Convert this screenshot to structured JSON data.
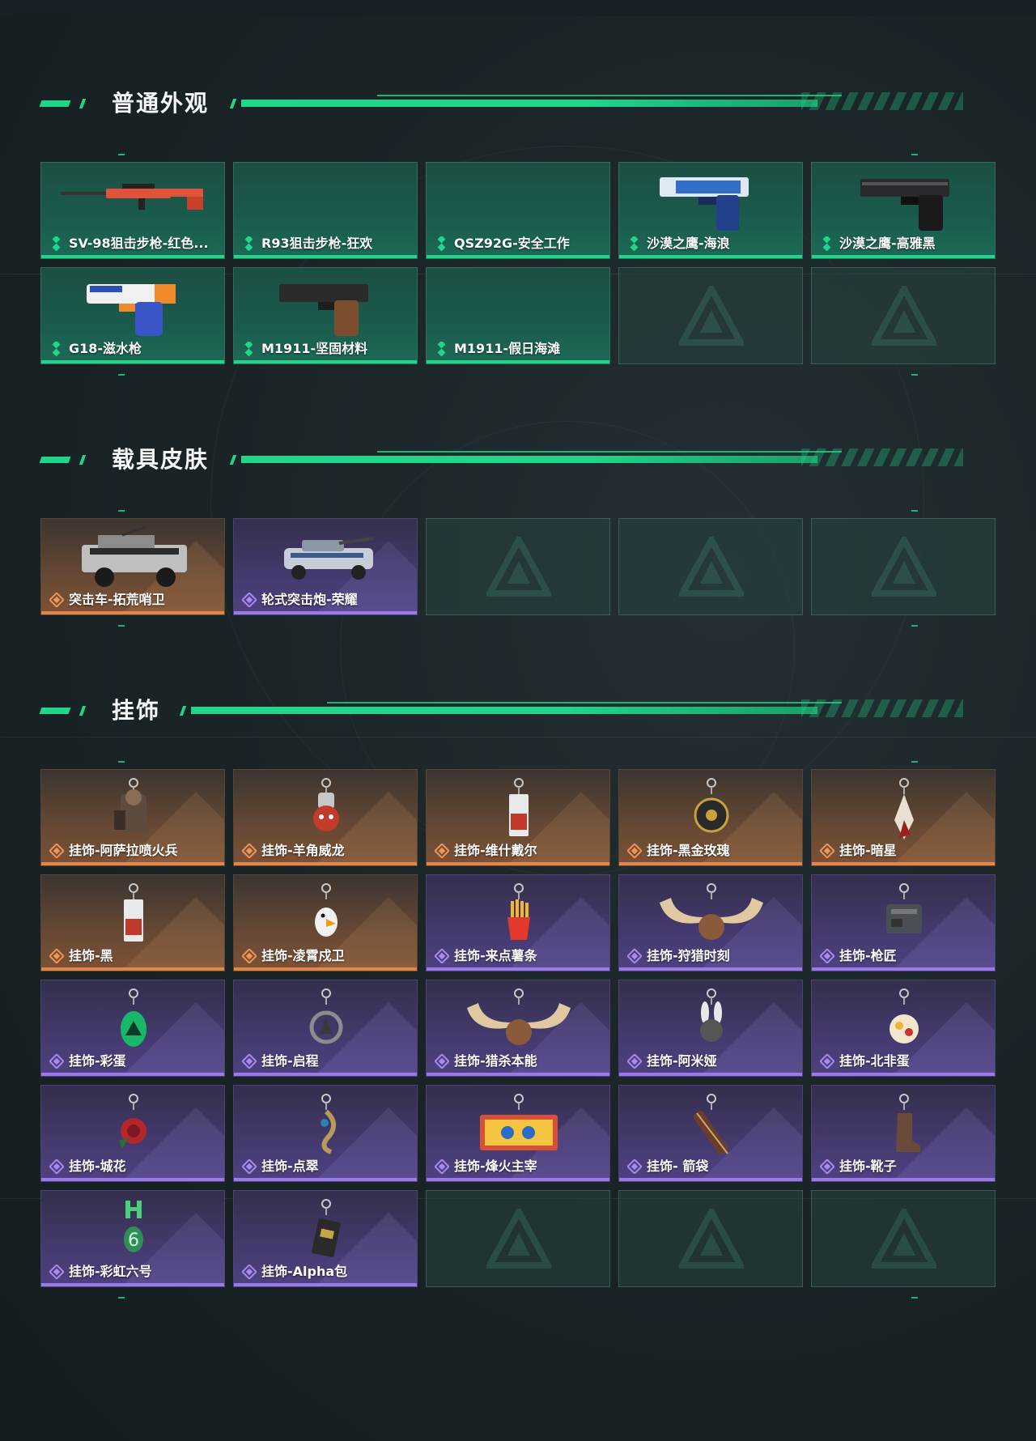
{
  "sections": [
    {
      "title": "普通外观",
      "items": [
        {
          "label": "SV-98狙击步枪-红色...",
          "rarity": "green",
          "art": "sniper-red"
        },
        {
          "label": "R93狙击步枪-狂欢",
          "rarity": "green",
          "art": "none"
        },
        {
          "label": "QSZ92G-安全工作",
          "rarity": "green",
          "art": "none"
        },
        {
          "label": "沙漠之鹰-海浪",
          "rarity": "green",
          "art": "pistol-blue"
        },
        {
          "label": "沙漠之鹰-高雅黑",
          "rarity": "green",
          "art": "pistol-black"
        },
        {
          "label": "G18-滋水枪",
          "rarity": "green",
          "art": "watergun"
        },
        {
          "label": "M1911-坚固材料",
          "rarity": "green",
          "art": "pistol-wood"
        },
        {
          "label": "M1911-假日海滩",
          "rarity": "green",
          "art": "none"
        },
        {
          "label": "",
          "rarity": "empty"
        },
        {
          "label": "",
          "rarity": "empty"
        }
      ]
    },
    {
      "title": "载具皮肤",
      "items": [
        {
          "label": "突击车-拓荒哨卫",
          "rarity": "orange",
          "art": "truck"
        },
        {
          "label": "轮式突击炮-荣耀",
          "rarity": "purple",
          "art": "tank"
        },
        {
          "label": "",
          "rarity": "empty"
        },
        {
          "label": "",
          "rarity": "empty"
        },
        {
          "label": "",
          "rarity": "empty"
        }
      ]
    },
    {
      "title": "挂饰",
      "items": [
        {
          "label": "挂饰-阿萨拉喷火兵",
          "rarity": "orange",
          "art": "charm-soldier"
        },
        {
          "label": "挂饰-羊角威龙",
          "rarity": "orange",
          "art": "charm-red"
        },
        {
          "label": "挂饰-维什戴尔",
          "rarity": "orange",
          "art": "charm-card"
        },
        {
          "label": "挂饰-黑金玫瑰",
          "rarity": "orange",
          "art": "charm-round"
        },
        {
          "label": "挂饰-暗星",
          "rarity": "orange",
          "art": "charm-feather"
        },
        {
          "label": "挂饰-黑",
          "rarity": "orange",
          "art": "charm-card"
        },
        {
          "label": "挂饰-凌霄戍卫",
          "rarity": "orange",
          "art": "charm-bird"
        },
        {
          "label": "挂饰-来点薯条",
          "rarity": "purple",
          "art": "charm-fries"
        },
        {
          "label": "挂饰-狩猎时刻",
          "rarity": "purple",
          "art": "charm-antler"
        },
        {
          "label": "挂饰-枪匠",
          "rarity": "purple",
          "art": "charm-box"
        },
        {
          "label": "挂饰-彩蛋",
          "rarity": "purple",
          "art": "charm-egg"
        },
        {
          "label": "挂饰-启程",
          "rarity": "purple",
          "art": "charm-ring"
        },
        {
          "label": "挂饰-猎杀本能",
          "rarity": "purple",
          "art": "charm-antler"
        },
        {
          "label": "挂饰-阿米娅",
          "rarity": "purple",
          "art": "charm-bunny"
        },
        {
          "label": "挂饰-北非蛋",
          "rarity": "purple",
          "art": "charm-plate"
        },
        {
          "label": "挂饰-城花",
          "rarity": "purple",
          "art": "charm-rose"
        },
        {
          "label": "挂饰-点翠",
          "rarity": "purple",
          "art": "charm-hook"
        },
        {
          "label": "挂饰-烽火主宰",
          "rarity": "purple",
          "art": "charm-sign"
        },
        {
          "label": "挂饰- 箭袋",
          "rarity": "purple",
          "art": "charm-quiver"
        },
        {
          "label": "挂饰-靴子",
          "rarity": "purple",
          "art": "charm-boot"
        },
        {
          "label": "挂饰-彩虹六号",
          "rarity": "purple",
          "art": "charm-six"
        },
        {
          "label": "挂饰-Alpha包",
          "rarity": "purple",
          "art": "charm-pack"
        },
        {
          "label": "",
          "rarity": "empty"
        },
        {
          "label": "",
          "rarity": "empty"
        },
        {
          "label": "",
          "rarity": "empty"
        }
      ]
    }
  ],
  "colors": {
    "accent_green": "#1fd68a",
    "rarity_green": "#1fd68a",
    "rarity_orange": "#e4864a",
    "rarity_purple": "#9b79e8"
  }
}
